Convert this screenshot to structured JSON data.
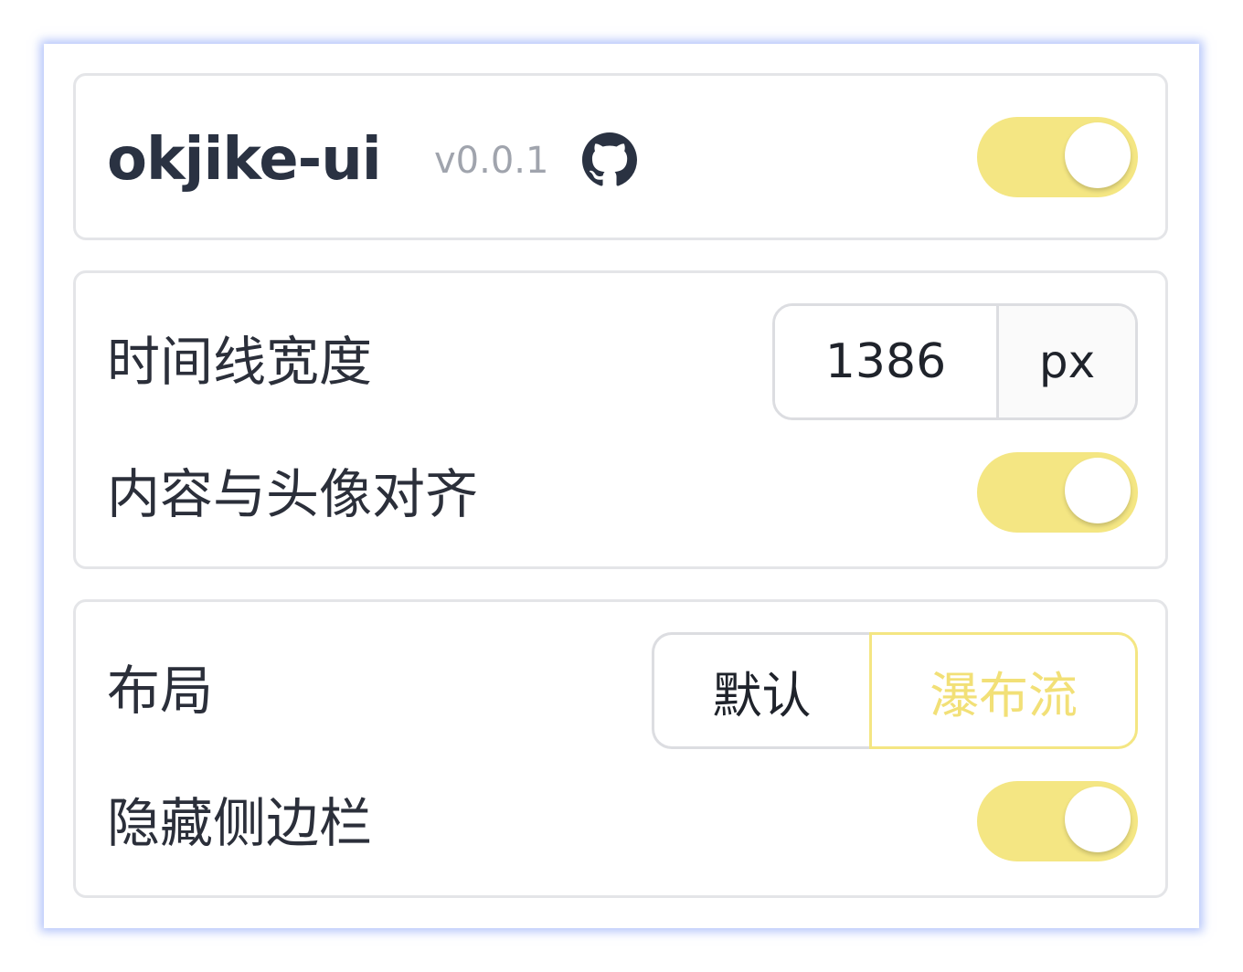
{
  "header": {
    "title": "okjike-ui",
    "version": "v0.0.1",
    "github_icon": "github-icon",
    "enabled": true
  },
  "timeline": {
    "width_label": "时间线宽度",
    "width_value": "1386",
    "width_unit": "px",
    "align_label": "内容与头像对齐",
    "align_enabled": true
  },
  "layout": {
    "layout_label": "布局",
    "options": [
      "默认",
      "瀑布流"
    ],
    "selected": "瀑布流",
    "hide_sidebar_label": "隐藏侧边栏",
    "hide_sidebar_enabled": true
  },
  "colors": {
    "accent": "#f4e683",
    "accent_text": "#f2e077",
    "border": "#e4e5e8",
    "glow": "#7896f5"
  }
}
